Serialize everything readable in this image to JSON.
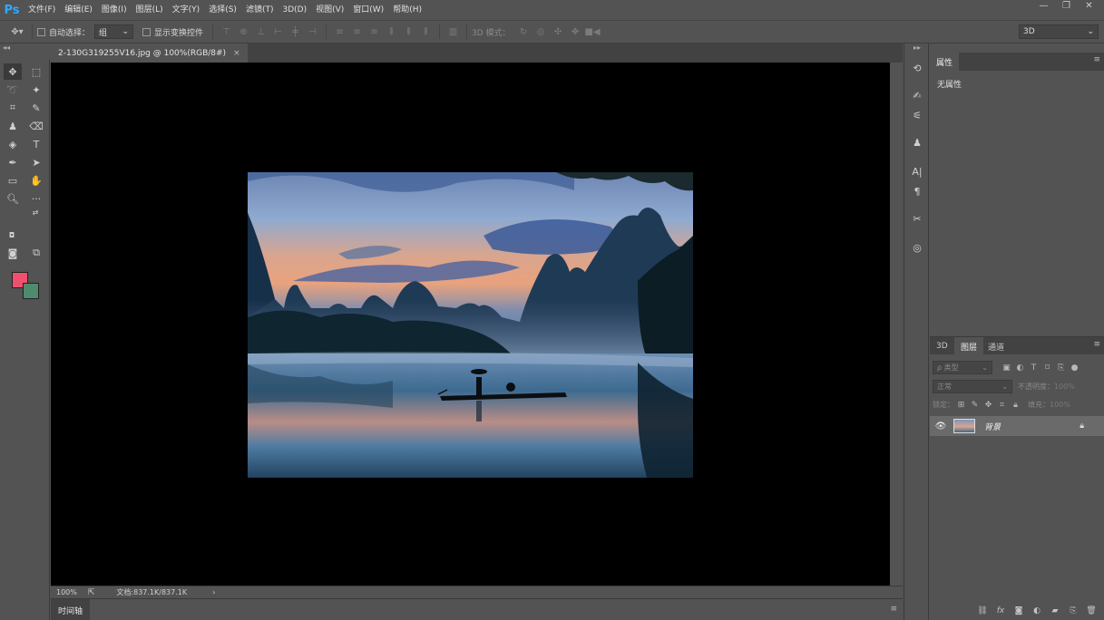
{
  "app": {
    "logo": "Ps"
  },
  "menu": [
    "文件(F)",
    "编辑(E)",
    "图像(I)",
    "图层(L)",
    "文字(Y)",
    "选择(S)",
    "滤镜(T)",
    "3D(D)",
    "视图(V)",
    "窗口(W)",
    "帮助(H)"
  ],
  "window_controls": {
    "minimize": "—",
    "restore": "❐",
    "close": "✕"
  },
  "options": {
    "auto_select_label": "自动选择：",
    "auto_select_value": "组",
    "show_transform_label": "显示变换控件",
    "mode_3d_label": "3D 模式：",
    "workspace_value": "3D"
  },
  "document": {
    "tab_title": "2-130G319255V16.jpg @ 100%(RGB/8#)",
    "close": "×"
  },
  "status": {
    "zoom": "100%",
    "doc_size": "文档:837.1K/837.1K",
    "arrow": "›"
  },
  "timeline": {
    "tab": "时间轴"
  },
  "properties": {
    "tab": "属性",
    "empty_text": "无属性"
  },
  "layers_panel": {
    "tabs": [
      "3D",
      "图层",
      "通道"
    ],
    "filter_placeholder": "ρ 类型",
    "blend_mode": "正常",
    "opacity_label": "不透明度：",
    "opacity_value": "100%",
    "lock_label": "锁定：",
    "fill_label": "填充：",
    "fill_value": "100%",
    "layer_name": "背景"
  },
  "colors": {
    "foreground": "#f0506e",
    "background": "#4f8a6f",
    "accent": "#31a8ff"
  }
}
